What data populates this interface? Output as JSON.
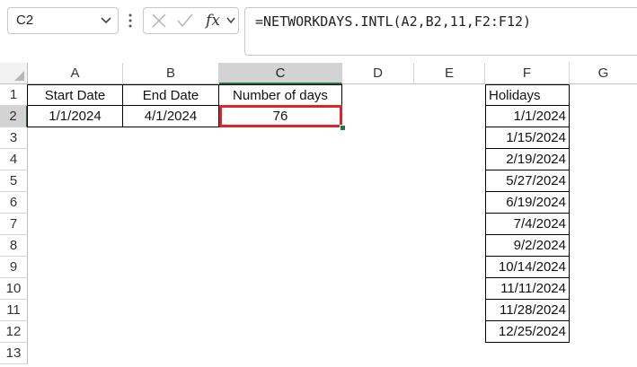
{
  "formula_bar": {
    "name_box": "C2",
    "formula": "=NETWORKDAYS.INTL(A2,B2,11,F2:F12)",
    "icons": [
      "chevron-down-icon",
      "more-vertical-icon",
      "cancel-x-icon",
      "enter-check-icon",
      "insert-function-icon"
    ],
    "fx_label": "fx"
  },
  "columns": [
    "A",
    "B",
    "C",
    "D",
    "E",
    "F",
    "G"
  ],
  "selected_column": "C",
  "rows": [
    "1",
    "2",
    "3",
    "4",
    "5",
    "6",
    "7",
    "8",
    "9",
    "10",
    "11",
    "12",
    "13"
  ],
  "selected_row": "2",
  "cells": {
    "A1": "Start Date",
    "B1": "End Date",
    "C1": "Number of days",
    "A2": "1/1/2024",
    "B2": "4/1/2024",
    "C2": "76",
    "F1": "Holidays"
  },
  "holidays": [
    "1/1/2024",
    "1/15/2024",
    "2/19/2024",
    "5/27/2024",
    "6/19/2024",
    "7/4/2024",
    "9/2/2024",
    "10/14/2024",
    "11/11/2024",
    "11/28/2024",
    "12/25/2024"
  ],
  "colors": {
    "selection_highlight": "#e0222a",
    "excel_green": "#217346",
    "header_selected_bg": "#d3d3d3"
  }
}
